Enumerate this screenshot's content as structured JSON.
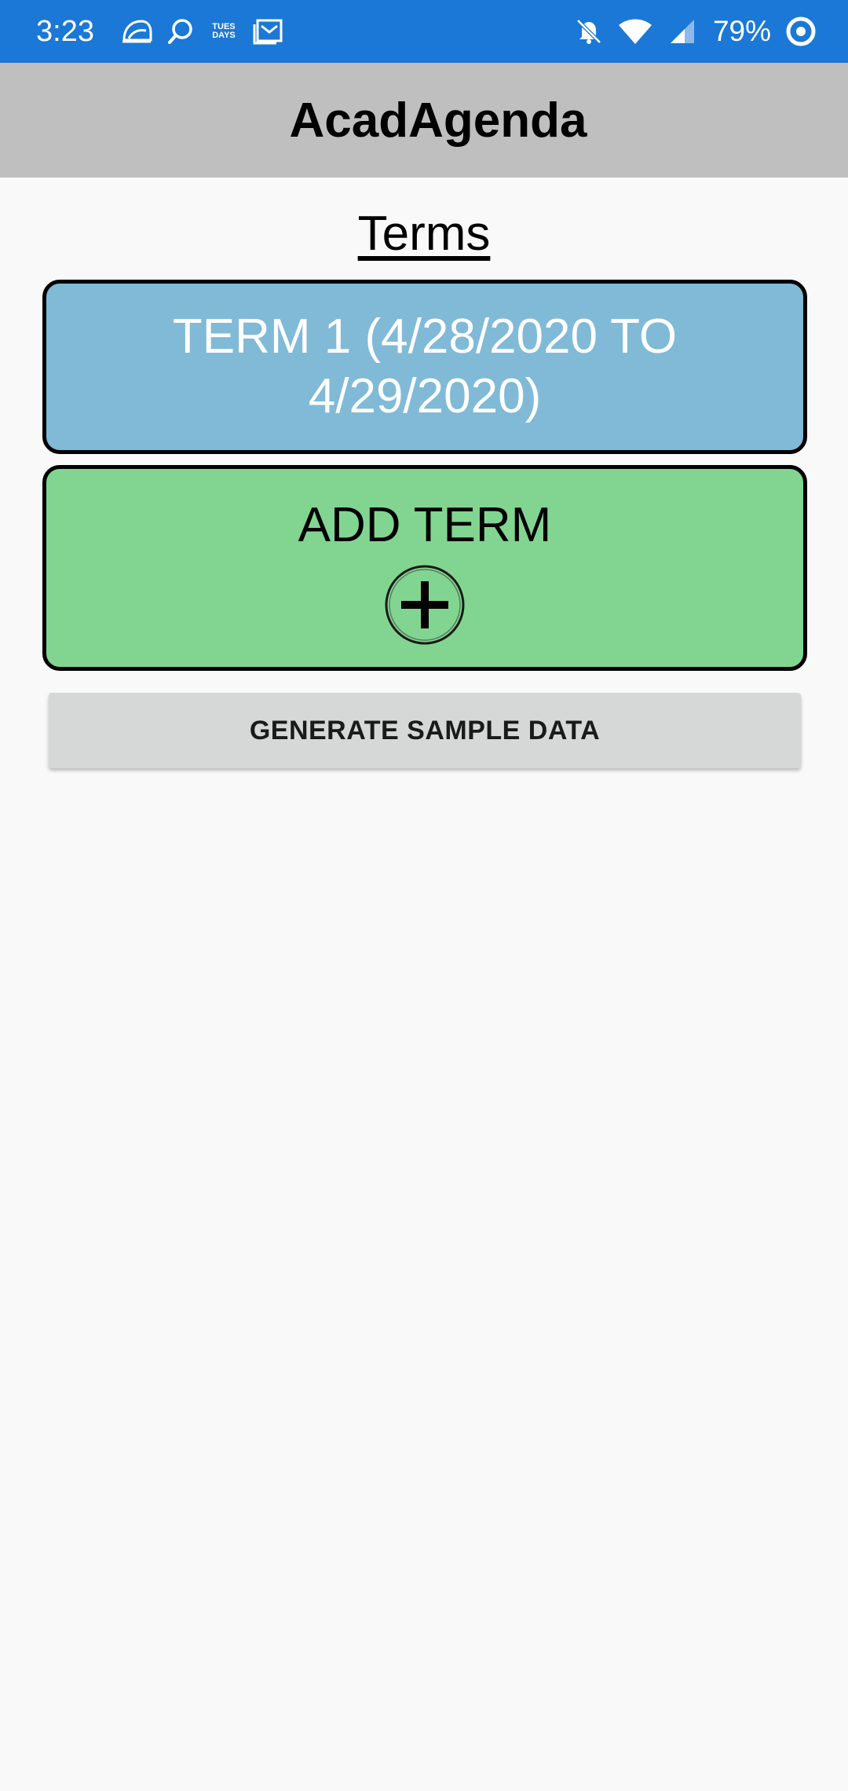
{
  "status_bar": {
    "time": "3:23",
    "battery_percent": "79%",
    "notification_icons": [
      "taco-bell-icon",
      "search-bubble-icon",
      "tuesdays-icon",
      "mail-icon"
    ],
    "tuesdays_icon_text": "TUES DAYS",
    "system_icons": [
      "bell-off-icon",
      "wifi-icon",
      "signal-icon",
      "battery-saver-icon"
    ],
    "color": "#1b78d6"
  },
  "app_bar": {
    "title": "AcadAgenda",
    "color": "#bfbfbf"
  },
  "main": {
    "section_title": "Terms",
    "terms": [
      {
        "label": "TERM 1 (4/28/2020 TO 4/29/2020)",
        "color": "#80bad7"
      }
    ],
    "add_term": {
      "label": "ADD TERM",
      "icon": "plus-circle-icon",
      "color": "#82d591"
    },
    "generate_button": {
      "label": "GENERATE SAMPLE DATA"
    }
  }
}
